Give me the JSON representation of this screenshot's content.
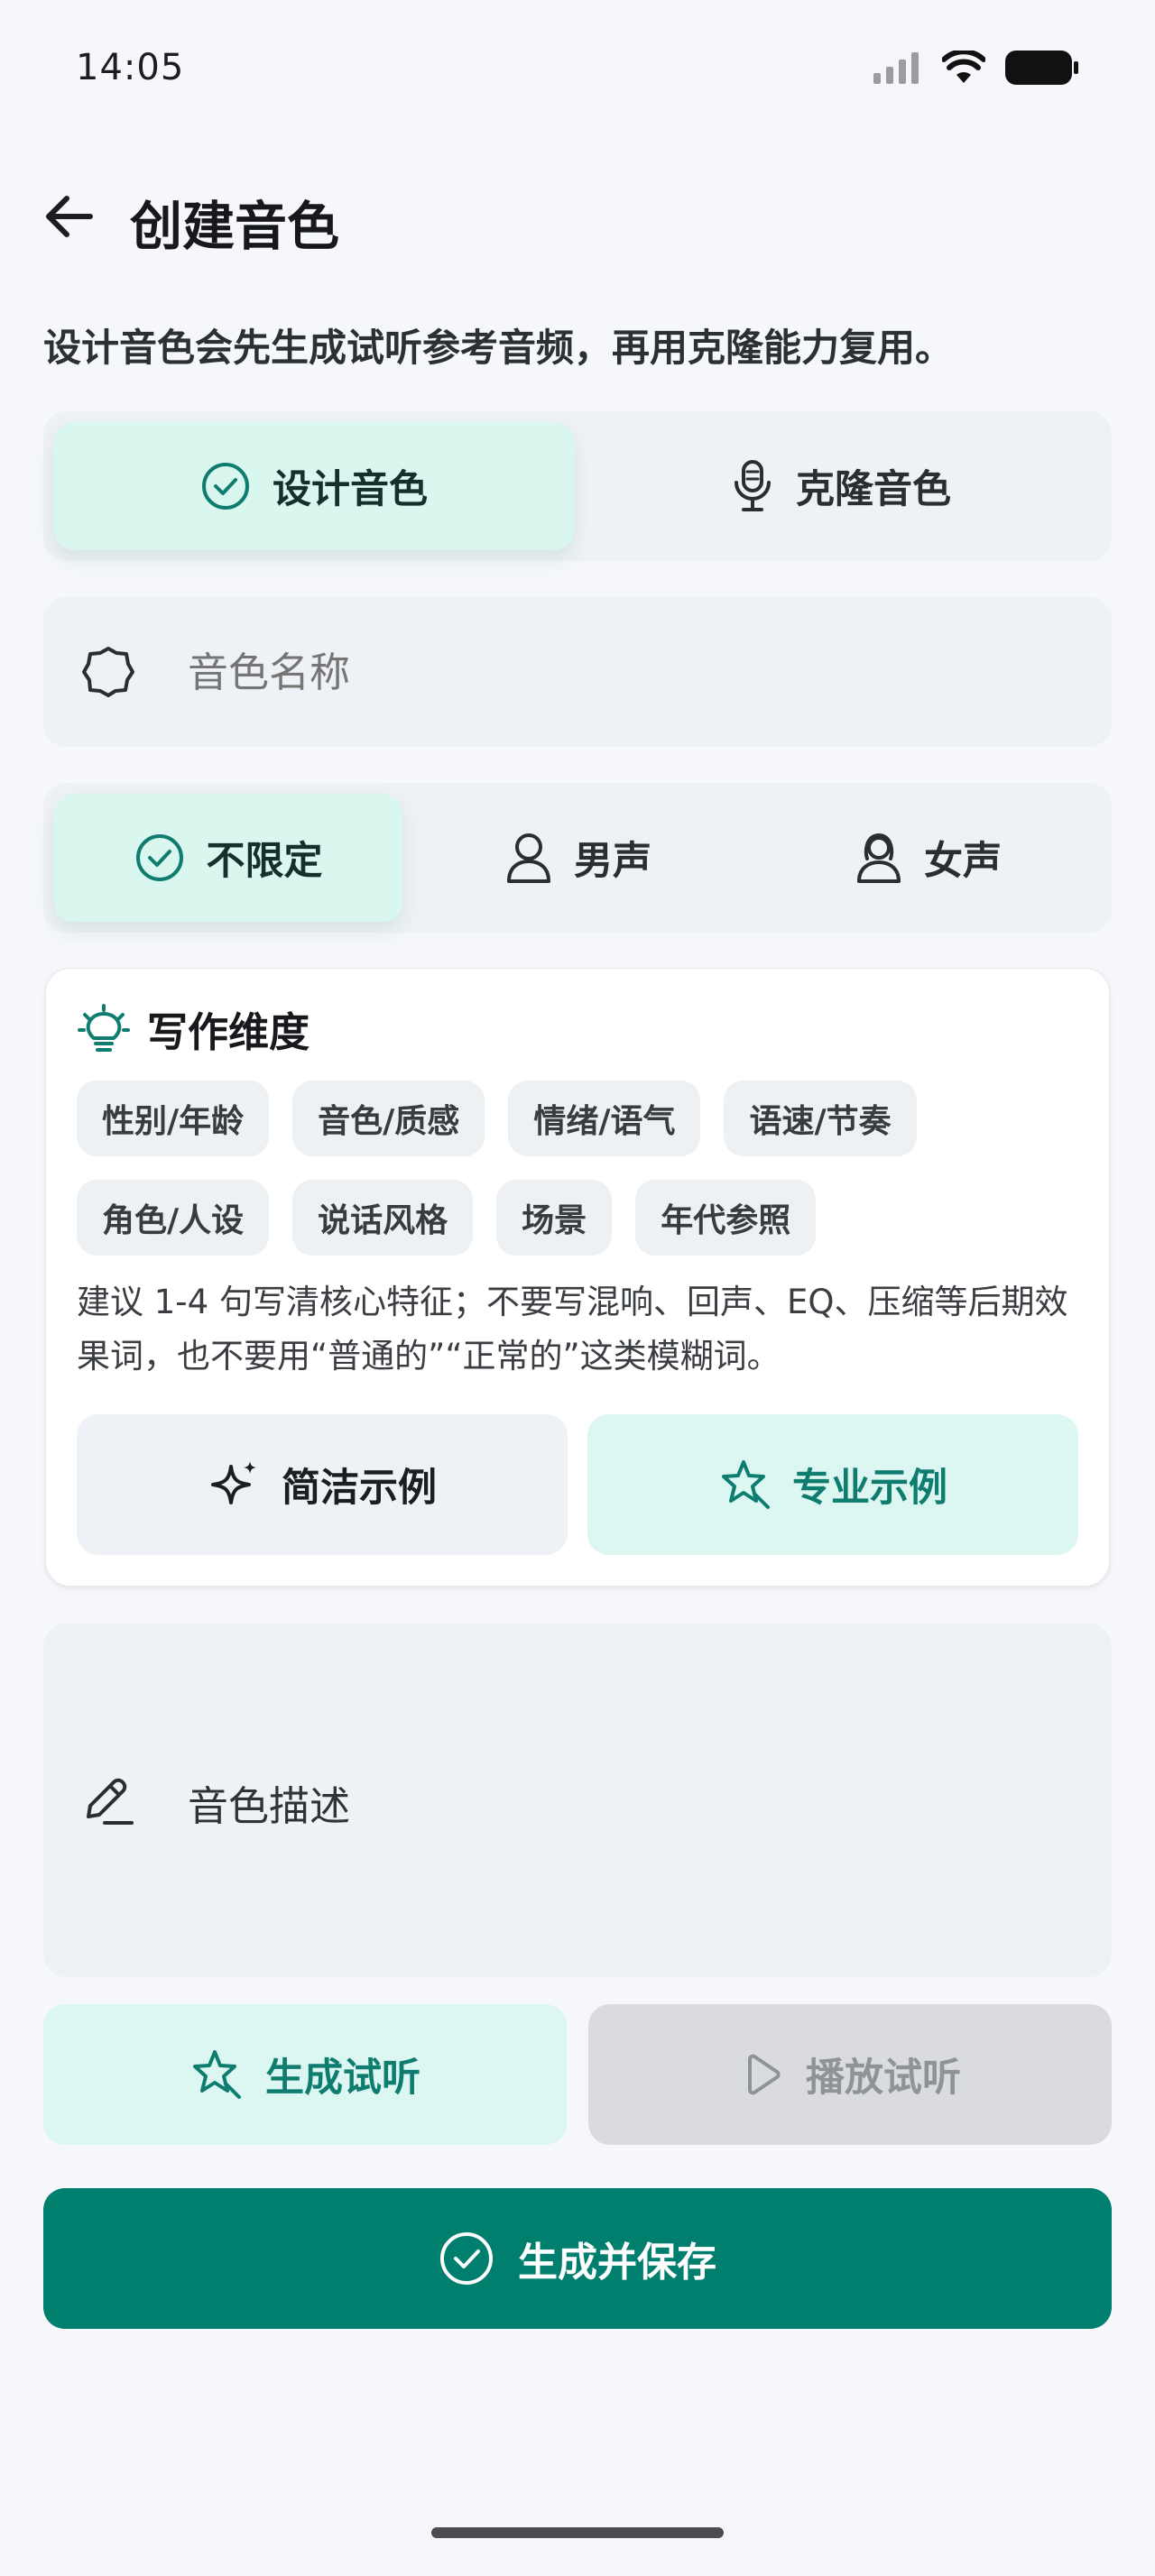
{
  "status_bar": {
    "time": "14:05"
  },
  "header": {
    "title": "创建音色"
  },
  "subtitle": "设计音色会先生成试听参考音频，再用克隆能力复用。",
  "mode_tabs": [
    {
      "label": "设计音色",
      "icon": "check-circle-icon",
      "selected": true
    },
    {
      "label": "克隆音色",
      "icon": "microphone-icon",
      "selected": false
    }
  ],
  "name_input": {
    "placeholder": "音色名称",
    "value": "",
    "icon": "badge-icon"
  },
  "gender_tabs": [
    {
      "label": "不限定",
      "icon": "check-circle-icon",
      "selected": true
    },
    {
      "label": "男声",
      "icon": "male-person-icon",
      "selected": false
    },
    {
      "label": "女声",
      "icon": "female-person-icon",
      "selected": false
    }
  ],
  "writing_card": {
    "title": "写作维度",
    "icon": "lightbulb-icon",
    "chips_row1": [
      "性别/年龄",
      "音色/质感",
      "情绪/语气",
      "语速/节奏"
    ],
    "chips_row2": [
      "角色/人设",
      "说话风格",
      "场景",
      "年代参照"
    ],
    "hint": "建议 1-4 句写清核心特征；不要写混响、回声、EQ、压缩等后期效果词，也不要用“普通的”“正常的”这类模糊词。",
    "simple_example_label": "简洁示例",
    "pro_example_label": "专业示例"
  },
  "description_input": {
    "placeholder": "音色描述",
    "value": "",
    "icon": "pencil-icon"
  },
  "actions": {
    "generate_label": "生成试听",
    "play_label": "播放试听",
    "play_enabled": false,
    "save_label": "生成并保存"
  },
  "colors": {
    "accent": "#007f6f",
    "accent_light": "#dcf6f1",
    "surface": "#eef1f5",
    "background": "#f5f7fa",
    "disabled": "#dadbdf"
  }
}
